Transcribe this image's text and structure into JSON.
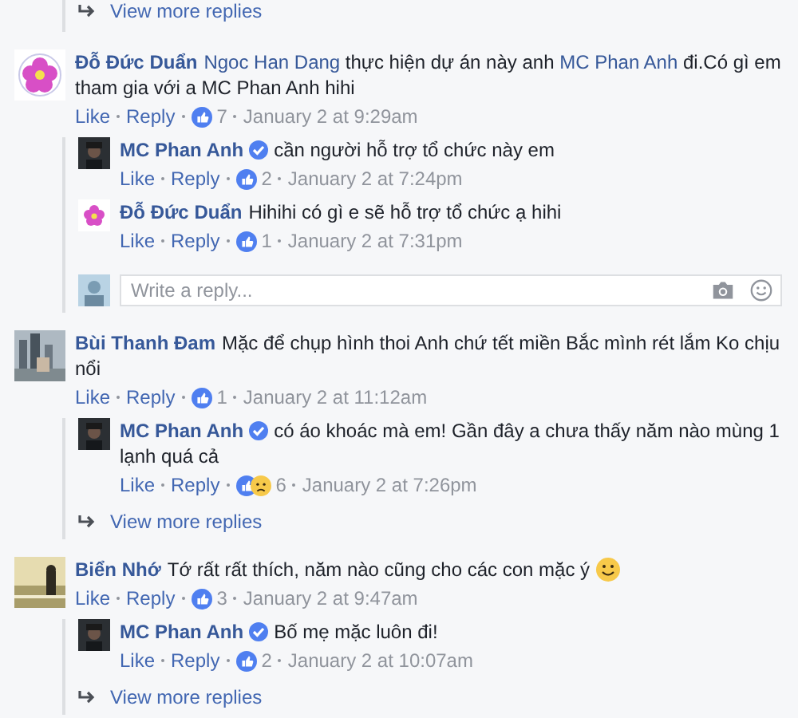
{
  "top_more": {
    "label": "View more replies"
  },
  "comments": [
    {
      "author": "Đỗ Đức Duẩn",
      "segments": [
        {
          "kind": "link",
          "text": "Ngoc Han Dang"
        },
        {
          "kind": "plain",
          "text": " thực hiện dự án này anh "
        },
        {
          "kind": "link",
          "text": "MC Phan Anh"
        },
        {
          "kind": "plain",
          "text": " đi.Có gì em tham gia với a MC Phan Anh hihi"
        }
      ],
      "like": "Like",
      "reply": "Reply",
      "reactions": [
        {
          "kind": "like"
        }
      ],
      "count": "7",
      "time": "January 2 at 9:29am",
      "replies": [
        {
          "author": "MC Phan Anh",
          "verified": true,
          "text": "cần người hỗ trợ tổ chức này em",
          "like": "Like",
          "reply": "Reply",
          "reactions": [
            {
              "kind": "like"
            }
          ],
          "count": "2",
          "time": "January 2 at 7:24pm"
        },
        {
          "author": "Đỗ Đức Duẩn",
          "verified": false,
          "text": "Hihihi có gì e sẽ hỗ trợ tổ chức ạ hihi",
          "like": "Like",
          "reply": "Reply",
          "reactions": [
            {
              "kind": "like"
            }
          ],
          "count": "1",
          "time": "January 2 at 7:31pm"
        }
      ],
      "reply_box": {
        "placeholder": "Write a reply..."
      }
    },
    {
      "author": "Bùi Thanh Đam",
      "segments": [
        {
          "kind": "plain",
          "text": "Mặc để chụp hình thoi Anh chứ tết miền Bắc mình rét lắm Ko chịu nổi"
        }
      ],
      "like": "Like",
      "reply": "Reply",
      "reactions": [
        {
          "kind": "like"
        }
      ],
      "count": "1",
      "time": "January 2 at 11:12am",
      "replies": [
        {
          "author": "MC Phan Anh",
          "verified": true,
          "text": "có áo khoác mà em! Gần đây a chưa thấy năm nào mùng 1 lạnh quá cả",
          "like": "Like",
          "reply": "Reply",
          "reactions": [
            {
              "kind": "like"
            },
            {
              "kind": "sad"
            }
          ],
          "count": "6",
          "time": "January 2 at 7:26pm"
        }
      ],
      "more": "View more replies"
    },
    {
      "author": "Biển Nhớ",
      "segments": [
        {
          "kind": "plain",
          "text": "Tớ rất rất thích, năm nào cũng cho các con mặc ý"
        }
      ],
      "emoji": true,
      "like": "Like",
      "reply": "Reply",
      "reactions": [
        {
          "kind": "like"
        }
      ],
      "count": "3",
      "time": "January 2 at 9:47am",
      "replies": [
        {
          "author": "MC Phan Anh",
          "verified": true,
          "text": "Bố mẹ mặc luôn đi!",
          "like": "Like",
          "reply": "Reply",
          "reactions": [
            {
              "kind": "like"
            }
          ],
          "count": "2",
          "time": "January 2 at 10:07am"
        }
      ],
      "more": "View more replies"
    }
  ]
}
